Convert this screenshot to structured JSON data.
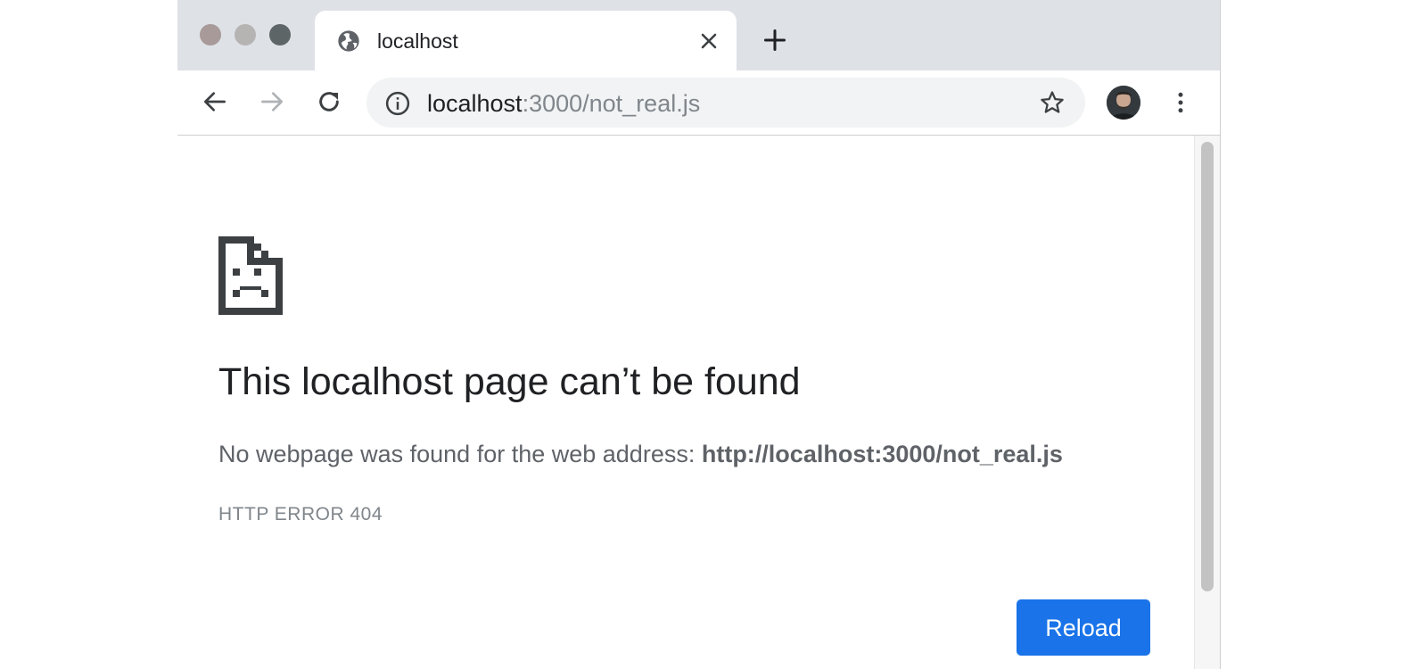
{
  "tab": {
    "title": "localhost"
  },
  "omnibox": {
    "host": "localhost",
    "rest": ":3000/not_real.js"
  },
  "error": {
    "heading": "This localhost page can’t be found",
    "description_prefix": "No webpage was found for the web address: ",
    "description_url": "http://localhost:3000/not_real.js",
    "code": "HTTP ERROR 404",
    "reload_label": "Reload"
  },
  "icons": {
    "tab_favicon": "globe-icon",
    "tab_close": "close-icon",
    "new_tab": "plus-icon",
    "back": "back-arrow-icon",
    "forward": "forward-arrow-icon",
    "reload": "reload-icon",
    "site_info": "info-icon",
    "bookmark": "star-icon",
    "profile": "avatar",
    "menu": "kebab-menu-icon",
    "error_illustration": "sad-document-icon"
  },
  "colors": {
    "accent": "#1a73e8",
    "tabstrip": "#dee1e6",
    "omnibox_bg": "#f1f3f4",
    "heading_text": "#202124",
    "body_text": "#5f6368"
  }
}
